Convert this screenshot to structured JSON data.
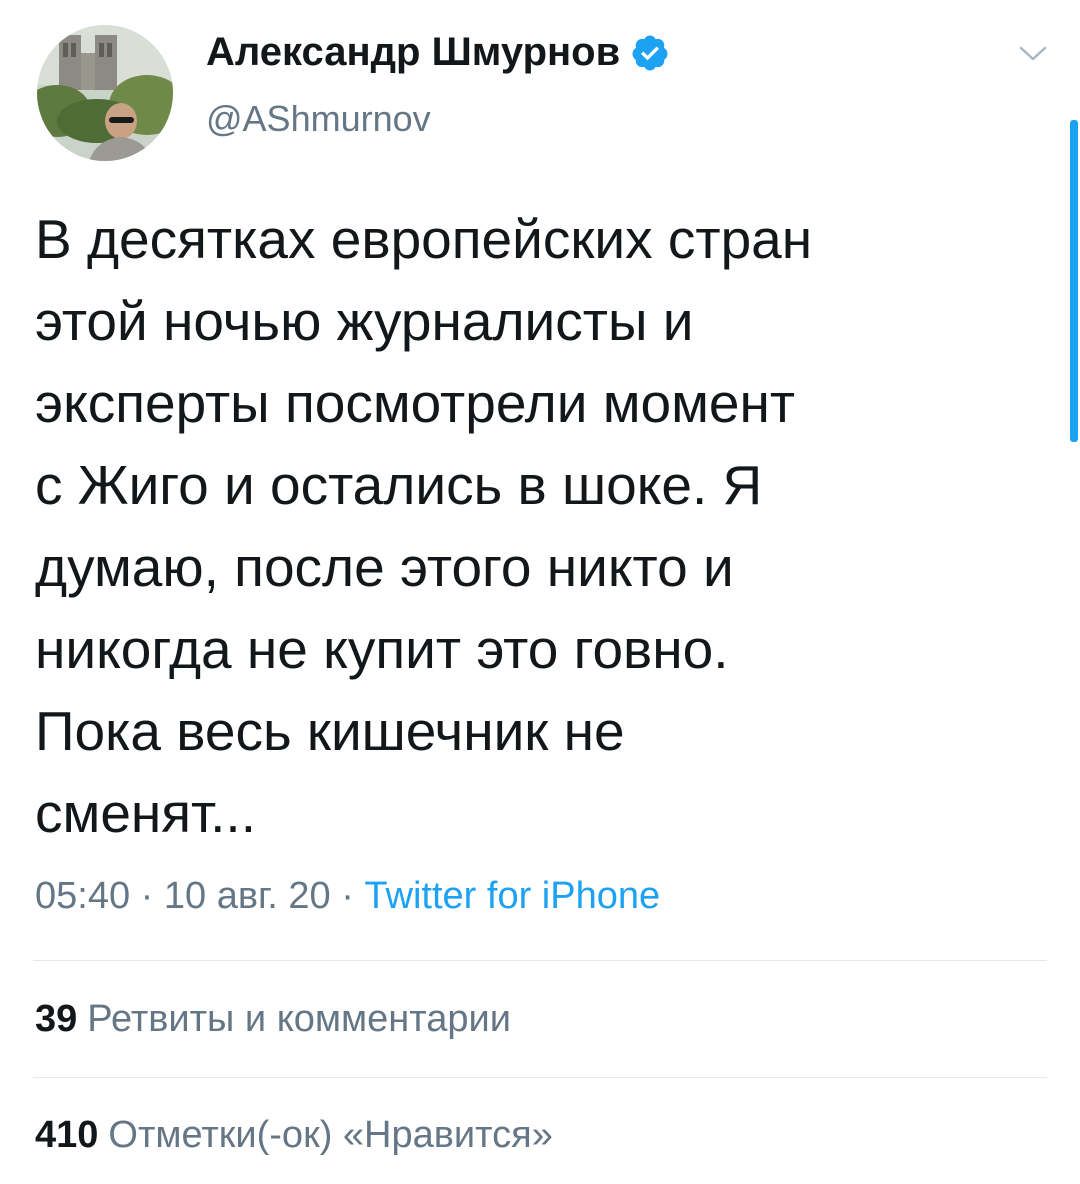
{
  "author": {
    "display_name": "Александр Шмурнов",
    "handle": "@AShmurnov",
    "verified": true,
    "avatar": "profile-photo"
  },
  "icons": {
    "verified": "verified-badge-icon",
    "menu": "chevron-down-icon"
  },
  "tweet": {
    "lines": [
      "В десятках европейских стран",
      "этой ночью журналисты и",
      "эксперты посмотрели момент",
      "с Жиго и остались в шоке. Я",
      "думаю, после этого никто и",
      "никогда не купит это говно.",
      "Пока весь кишечник не",
      "сменят..."
    ],
    "time": "05:40",
    "date": "10 авг. 20",
    "separator": " · ",
    "source": "Twitter for iPhone"
  },
  "stats": {
    "retweets_count": "39",
    "retweets_label": "Ретвиты и комментарии",
    "likes_count": "410",
    "likes_label": "Отметки(-ок) «Нравится»"
  },
  "colors": {
    "accent": "#1da1f2",
    "text": "#14171a",
    "secondary": "#657786",
    "divider": "#e1e8ed"
  }
}
